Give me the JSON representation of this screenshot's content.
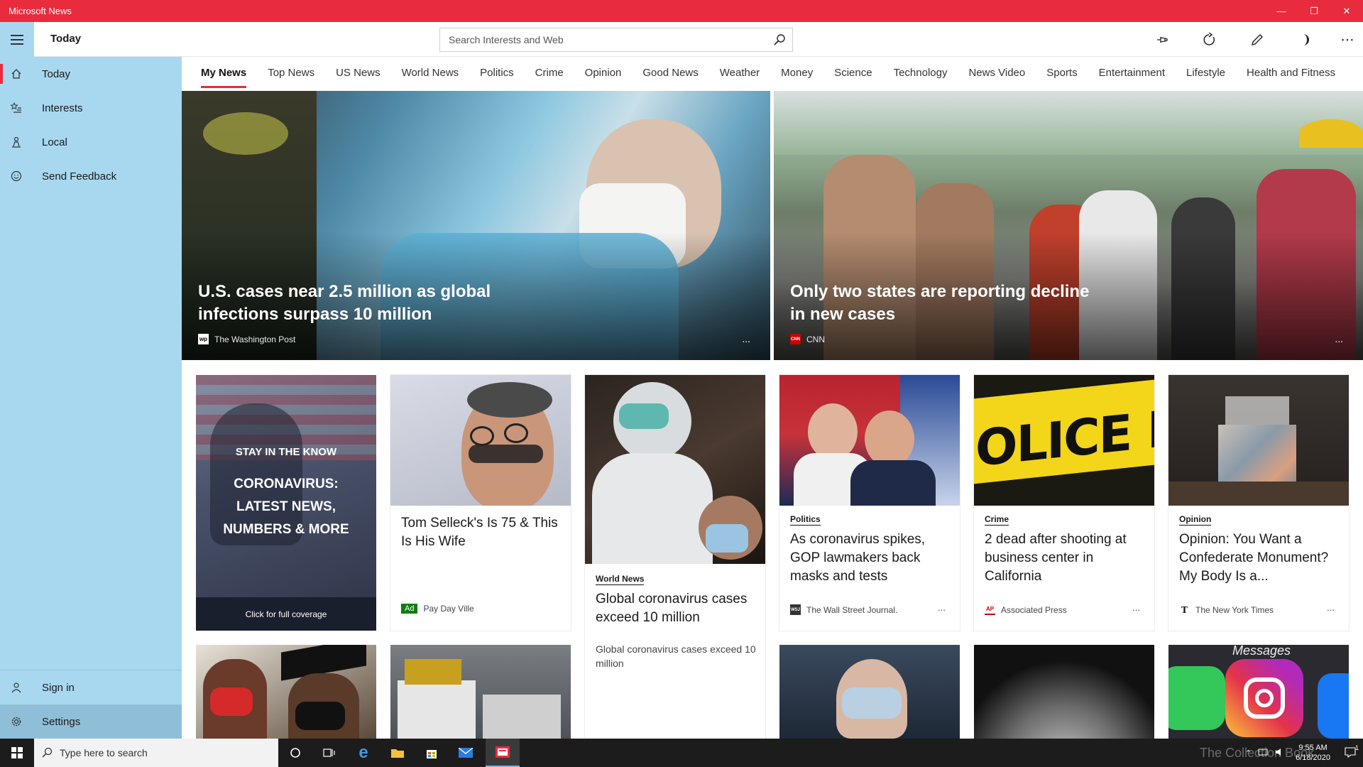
{
  "window": {
    "title": "Microsoft News"
  },
  "sidebar": {
    "items": [
      {
        "label": "Today"
      },
      {
        "label": "Interests"
      },
      {
        "label": "Local"
      },
      {
        "label": "Send Feedback"
      }
    ],
    "bottom": [
      {
        "label": "Sign in"
      },
      {
        "label": "Settings"
      }
    ]
  },
  "header": {
    "page_title": "Today",
    "search_placeholder": "Search Interests and Web"
  },
  "tabs": [
    "My News",
    "Top News",
    "US News",
    "World News",
    "Politics",
    "Crime",
    "Opinion",
    "Good News",
    "Weather",
    "Money",
    "Science",
    "Technology",
    "News Video",
    "Sports",
    "Entertainment",
    "Lifestyle",
    "Health and Fitness"
  ],
  "hero": [
    {
      "title": "U.S. cases near 2.5 million as global infections surpass 10 million",
      "source": "The Washington Post",
      "logo": "wp",
      "more": "..."
    },
    {
      "title": "Only two states are reporting decline in new cases",
      "source": "CNN",
      "logo": "CNN",
      "more": "..."
    }
  ],
  "promo": {
    "kicker": "STAY IN THE KNOW",
    "headline": "CORONAVIRUS: LATEST NEWS, NUMBERS & MORE",
    "footer": "Click for full coverage"
  },
  "cards": [
    {
      "title": "Tom Selleck's  Is 75 & This Is His Wife",
      "ad": "Ad",
      "source": "Pay Day Ville"
    },
    {
      "category": "World News",
      "title": "Global coronavirus cases exceed 10 million",
      "summary": "Global coronavirus cases exceed 10 million"
    },
    {
      "category": "Politics",
      "title": "As coronavirus spikes, GOP lawmakers back masks and tests",
      "source": "The Wall Street Journal.",
      "logo": "WSJ",
      "more": "..."
    },
    {
      "category": "Crime",
      "title": "2 dead after shooting at business center in California",
      "source": "Associated Press",
      "logo": "AP",
      "more": "..."
    },
    {
      "category": "Opinion",
      "title": "Opinion: You Want a Confederate Monument? My Body Is a...",
      "source": "The New York Times",
      "logo": "T",
      "more": "..."
    }
  ],
  "image_text": {
    "police": "OLICE LIN",
    "messages": "Messages"
  },
  "taskbar": {
    "search_placeholder": "Type here to search",
    "time": "9:55 AM",
    "date": "6/18/2020",
    "notification_count": "1"
  },
  "watermark": "The Collection Book",
  "colors": {
    "accent": "#e82c3e",
    "sidebar": "#a8d8f0",
    "ad_badge": "#107c10"
  }
}
